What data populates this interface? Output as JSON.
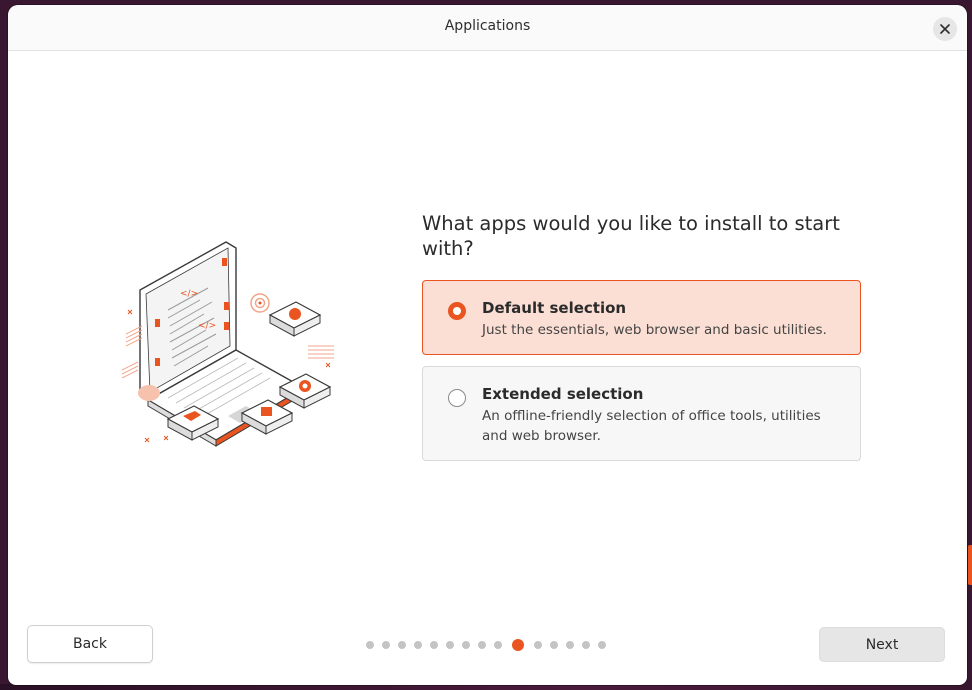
{
  "window": {
    "title": "Applications",
    "close_icon": "close-icon"
  },
  "main": {
    "question": "What apps would you like to install to start with?",
    "options": [
      {
        "title": "Default selection",
        "description": "Just the essentials, web browser and basic utilities.",
        "selected": true
      },
      {
        "title": "Extended selection",
        "description": "An offline-friendly selection of office tools, utilities and web browser.",
        "selected": false
      }
    ]
  },
  "footer": {
    "back_label": "Back",
    "next_label": "Next",
    "progress": {
      "total_steps": 15,
      "current_step": 10
    }
  },
  "colors": {
    "accent": "#e95420",
    "selected_bg": "#fcdfd4",
    "desktop_bg": "#3a1731"
  },
  "illustration": {
    "icon": "laptop-apps-illustration"
  }
}
